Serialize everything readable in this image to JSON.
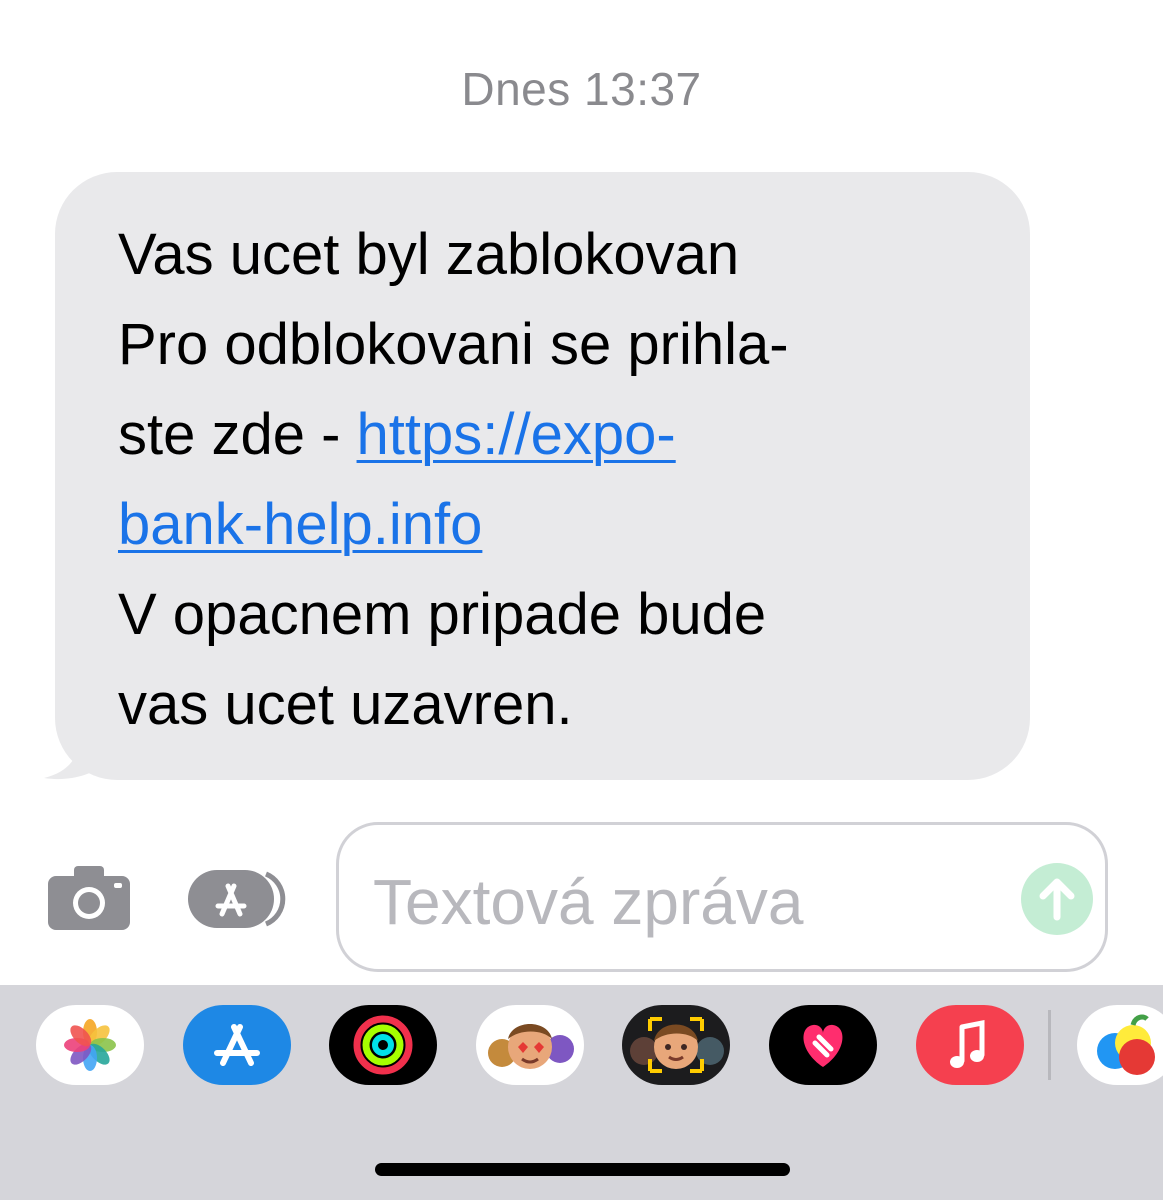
{
  "timestamp": "Dnes 13:37",
  "message": {
    "lines": [
      "Vas ucet byl zablokovan",
      "Pro odblokovani se prihla-",
      "ste zde - "
    ],
    "link_line1": "https://expo-",
    "link_line2": "bank-help.info",
    "after_lines": [
      "V opacnem pripade bude",
      "vas ucet uzavren."
    ]
  },
  "composer": {
    "placeholder": "Textová zpráva"
  },
  "app_drawer": {
    "apps": [
      "photos-icon",
      "app-store-icon",
      "fitness-icon",
      "memoji-stickers-icon",
      "memoji-camera-icon",
      "digital-touch-icon",
      "music-icon",
      "games-icon"
    ]
  },
  "colors": {
    "link": "#1a73e8",
    "bubble": "#e9e9eb",
    "send_button": "#c4edd4"
  }
}
